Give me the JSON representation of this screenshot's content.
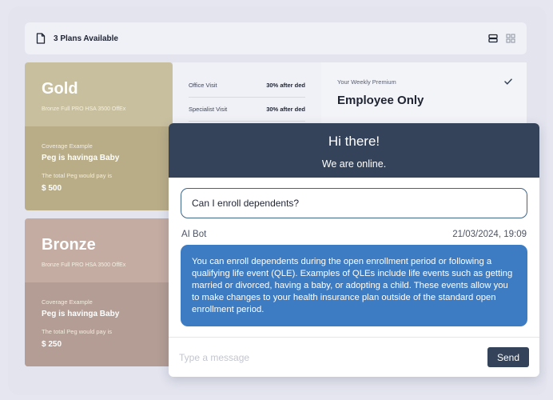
{
  "topbar": {
    "plans_label": "3 Plans Available",
    "icons": [
      "document-icon",
      "list-view-icon",
      "grid-view-icon"
    ]
  },
  "plans": [
    {
      "name": "Gold",
      "subtitle": "Bronze Full PRO HSA 3500 OffEx",
      "coverage_label": "Coverage Example",
      "coverage_text": "Peg is havinga Baby",
      "pay_label": "The total Peg would pay is",
      "pay_amount": "$ 500",
      "color": "#c8bf9f"
    },
    {
      "name": "Bronze",
      "subtitle": "Bronze Full PRO HSA 3500 OffEx",
      "coverage_label": "Coverage Example",
      "coverage_text": "Peg is havinga Baby",
      "pay_label": "The total Peg would pay is",
      "pay_amount": "$ 250",
      "color": "#c4aca2"
    }
  ],
  "details": [
    {
      "label": "Office Visit",
      "value": "30% after ded"
    },
    {
      "label": "Specialist Visit",
      "value": "30% after ded"
    }
  ],
  "premium": {
    "label": "Your Weekly Premium",
    "value": "Employee Only"
  },
  "chat": {
    "title": "Hi there!",
    "status": "We are online.",
    "question": "Can I enroll dependents?",
    "sender": "AI Bot",
    "timestamp": "21/03/2024, 19:09",
    "answer": "You can enroll dependents during the open enrollment period or following a qualifying life event (QLE). Examples of QLEs include life events such as getting married or divorced, having a baby, or adopting a child. These events allow you to make changes to your health insurance plan outside of the standard open enrollment period.",
    "input_placeholder": "Type a message",
    "send_label": "Send"
  },
  "colors": {
    "chat_header": "#344359",
    "answer_bubble": "#3d7cc2",
    "background": "#e6e6f0"
  }
}
